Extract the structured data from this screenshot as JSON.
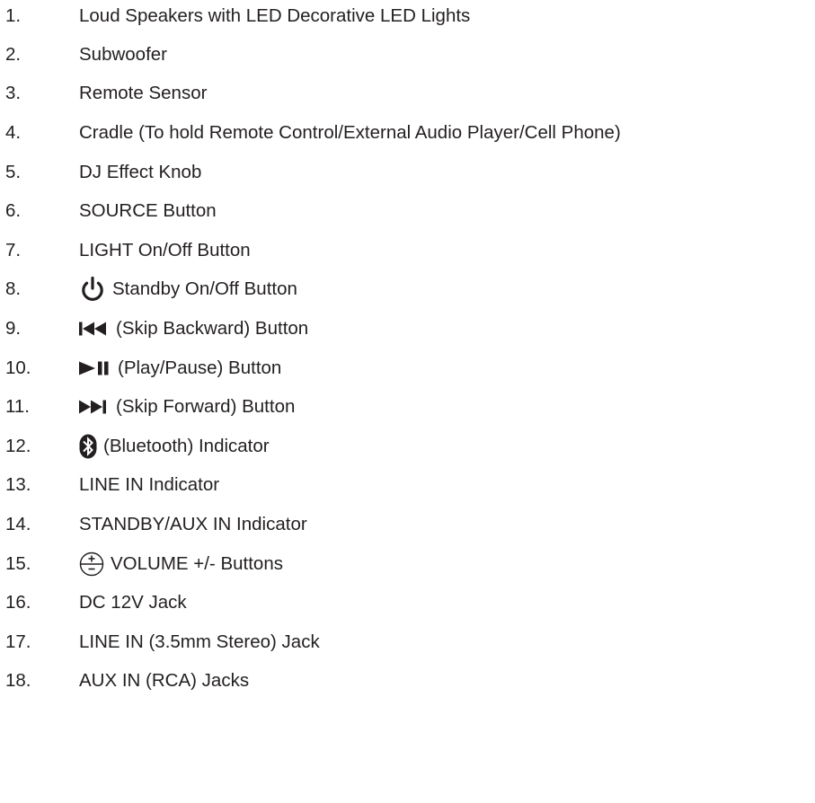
{
  "items": [
    {
      "num": "1.",
      "text": "Loud Speakers with LED Decorative LED Lights"
    },
    {
      "num": "2.",
      "text": "Subwoofer"
    },
    {
      "num": "3.",
      "text": "Remote Sensor"
    },
    {
      "num": "4.",
      "text": "Cradle (To hold Remote Control/External Audio Player/Cell Phone)"
    },
    {
      "num": "5.",
      "text": "DJ Effect Knob"
    },
    {
      "num": "6.",
      "text": "SOURCE Button"
    },
    {
      "num": "7.",
      "text": "LIGHT On/Off Button"
    },
    {
      "num": "8.",
      "icon": "power-icon",
      "text": "Standby On/Off Button"
    },
    {
      "num": "9.",
      "icon": "skip-backward-icon",
      "text": "(Skip Backward) Button"
    },
    {
      "num": "10.",
      "icon": "play-pause-icon",
      "text": "(Play/Pause) Button"
    },
    {
      "num": "11.",
      "icon": "skip-forward-icon",
      "text": "(Skip Forward) Button"
    },
    {
      "num": "12.",
      "icon": "bluetooth-icon",
      "text": "(Bluetooth) Indicator"
    },
    {
      "num": "13.",
      "text": "LINE IN Indicator"
    },
    {
      "num": "14.",
      "text": "STANDBY/AUX IN Indicator"
    },
    {
      "num": "15.",
      "icon": "volume-plus-minus-icon",
      "text": "VOLUME +/- Buttons"
    },
    {
      "num": "16.",
      "text": "DC 12V Jack"
    },
    {
      "num": "17.",
      "text": "LINE IN (3.5mm Stereo) Jack"
    },
    {
      "num": "18.",
      "text": "AUX IN (RCA) Jacks"
    }
  ],
  "colors": {
    "text": "#231f20",
    "background": "#ffffff"
  }
}
